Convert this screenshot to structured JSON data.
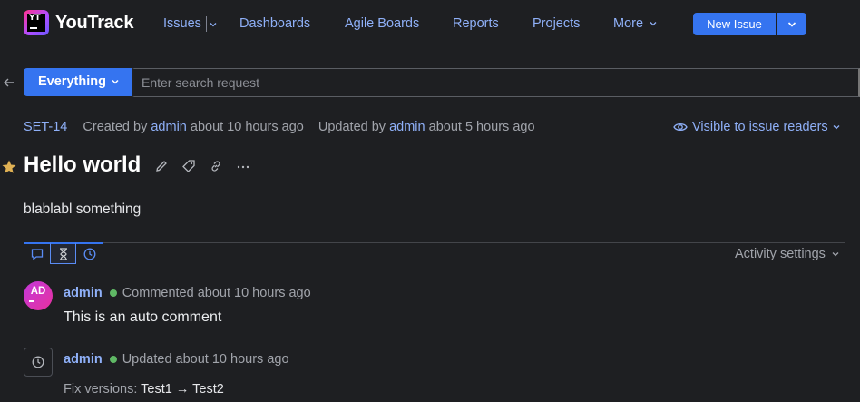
{
  "app": {
    "name": "YouTrack",
    "logo_letters": "YT"
  },
  "nav": {
    "items": [
      {
        "label": "Issues",
        "has_dropdown": true
      },
      {
        "label": "Dashboards"
      },
      {
        "label": "Agile Boards"
      },
      {
        "label": "Reports"
      },
      {
        "label": "Projects"
      },
      {
        "label": "More",
        "has_dropdown": true
      }
    ],
    "new_issue_label": "New Issue",
    "icons": [
      "chevron-down-icon"
    ]
  },
  "search": {
    "scope_label": "Everything",
    "placeholder": "Enter search request",
    "value": ""
  },
  "issue": {
    "id": "SET-14",
    "created_prefix": "Created by",
    "created_by": "admin",
    "created_time": "about 10 hours ago",
    "updated_prefix": "Updated by",
    "updated_by": "admin",
    "updated_time": "about 5 hours ago",
    "visibility_label": "Visible to issue readers",
    "title": "Hello world",
    "description": "blablabl something",
    "starred": true,
    "tool_icons": [
      "pencil-icon",
      "tag-icon",
      "link-icon",
      "more-icon"
    ]
  },
  "activity": {
    "tabs": [
      "comments-tab",
      "history-tab",
      "time-tab"
    ],
    "selected_tab": "history-tab",
    "settings_label": "Activity settings",
    "entries": [
      {
        "avatar_initials": "AD",
        "author": "admin",
        "action": "Commented about 10 hours ago",
        "text": "This is an auto comment",
        "online": true
      },
      {
        "author": "admin",
        "action": "Updated about 10 hours ago",
        "field_label": "Fix versions:",
        "old_value": "Test1",
        "arrow": "→",
        "new_value": "Test2",
        "online": true
      }
    ]
  },
  "colors": {
    "background": "#1e1f22",
    "accent": "#3574f0",
    "link": "#8fb0f8",
    "online": "#5fb865",
    "star": "#e0b154"
  }
}
